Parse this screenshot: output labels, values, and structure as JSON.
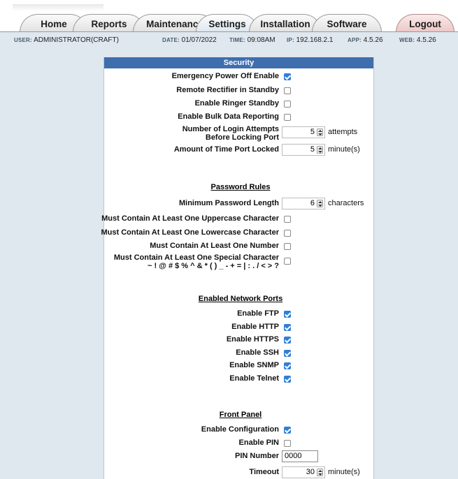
{
  "tabs": [
    {
      "label": "Home"
    },
    {
      "label": "Reports"
    },
    {
      "label": "Maintenance"
    },
    {
      "label": "Settings"
    },
    {
      "label": "Installation"
    },
    {
      "label": "Software"
    },
    {
      "label": "Logout"
    }
  ],
  "info": {
    "user_key": "USER:",
    "user": "ADMINISTRATOR(CRAFT)",
    "date_key": "DATE:",
    "date": "01/07/2022",
    "time_key": "TIME:",
    "time": "09:08AM",
    "ip_key": "IP:",
    "ip": "192.168.2.1",
    "app_key": "APP:",
    "app": "4.5.26",
    "web_key": "WEB:",
    "web": "4.5.26"
  },
  "security": {
    "title": "Security",
    "emergency_power_off": {
      "label": "Emergency Power Off Enable",
      "checked": true
    },
    "remote_rectifier": {
      "label": "Remote Rectifier in Standby",
      "checked": false
    },
    "ringer_standby": {
      "label": "Enable Ringer Standby",
      "checked": false
    },
    "bulk_data": {
      "label": "Enable Bulk Data Reporting",
      "checked": false
    },
    "login_attempts": {
      "label_line1": "Number of Login Attempts",
      "label_line2": "Before Locking Port",
      "value": "5",
      "unit": "attempts"
    },
    "time_locked": {
      "label": "Amount of Time Port Locked",
      "value": "5",
      "unit": "minute(s)"
    }
  },
  "password_rules": {
    "heading": "Password Rules",
    "min_length": {
      "label": "Minimum Password Length",
      "value": "6",
      "unit": "characters"
    },
    "uppercase": {
      "label": "Must Contain At Least One Uppercase Character",
      "checked": false
    },
    "lowercase": {
      "label": "Must Contain At Least One Lowercase Character",
      "checked": false
    },
    "number": {
      "label": "Must Contain At Least One Number",
      "checked": false
    },
    "special": {
      "label_line1": "Must Contain At Least One Special Character",
      "label_line2": "~ ! @ # $ % ^ & * ( ) _ - + = | : . / < > ?",
      "checked": false
    }
  },
  "network_ports": {
    "heading": "Enabled Network Ports",
    "items": [
      {
        "label": "Enable FTP",
        "checked": true
      },
      {
        "label": "Enable HTTP",
        "checked": true
      },
      {
        "label": "Enable HTTPS",
        "checked": true
      },
      {
        "label": "Enable SSH",
        "checked": true
      },
      {
        "label": "Enable SNMP",
        "checked": true
      },
      {
        "label": "Enable Telnet",
        "checked": true
      }
    ]
  },
  "front_panel": {
    "heading": "Front Panel",
    "configuration": {
      "label": "Enable Configuration",
      "checked": true
    },
    "pin": {
      "label": "Enable PIN",
      "checked": false
    },
    "pin_number": {
      "label": "PIN Number",
      "value": "0000"
    },
    "timeout": {
      "label": "Timeout",
      "value": "30",
      "unit": "minute(s)"
    }
  }
}
